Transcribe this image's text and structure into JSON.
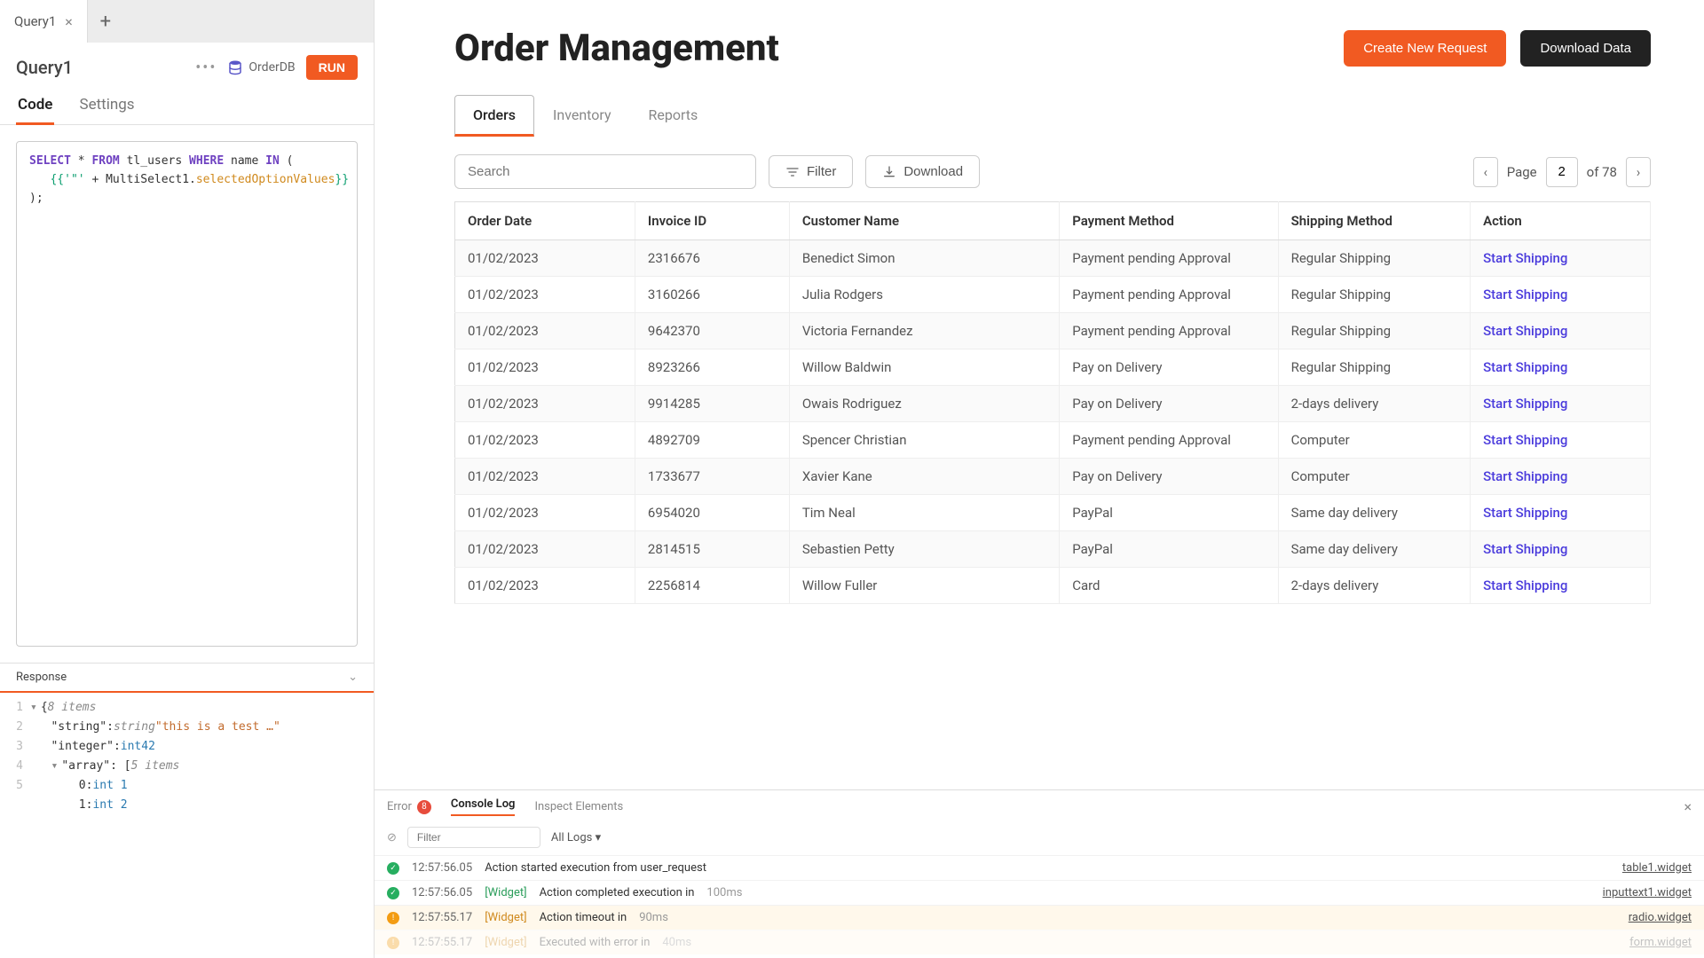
{
  "left": {
    "tab_name": "Query1",
    "query_title": "Query1",
    "db_name": "OrderDB",
    "run_label": "RUN",
    "inner_tabs": {
      "code": "Code",
      "settings": "Settings"
    },
    "sql_kw_select": "SELECT",
    "sql_kw_from": "FROM",
    "sql_kw_where": "WHERE",
    "sql_kw_in": "IN",
    "sql_table": "tl_users",
    "sql_col": "name",
    "sql_bind_open": "{{'\"'",
    "sql_bind_obj": " + MultiSelect1.",
    "sql_bind_prop": "selectedOptionValues",
    "sql_bind_close": "}}",
    "response_label": "Response",
    "json": {
      "items_count": "8 items",
      "k_string": "\"string\"",
      "t_string": "string",
      "v_string": "\"this is a test …\"",
      "k_integer": "\"integer\"",
      "t_int": "int",
      "v_int": "42",
      "k_array": "\"array\"",
      "arr_count": "5 items",
      "idx0": "0",
      "v0": "int 1",
      "idx1": "1",
      "v1": "int 2"
    }
  },
  "page": {
    "title": "Order Management",
    "btn_create": "Create New Request",
    "btn_download": "Download Data",
    "tabs": {
      "orders": "Orders",
      "inventory": "Inventory",
      "reports": "Reports"
    },
    "search_placeholder": "Search",
    "filter_label": "Filter",
    "download_label": "Download",
    "page_label": "Page",
    "page_current": "2",
    "page_of": "of 78"
  },
  "table": {
    "headers": {
      "date": "Order Date",
      "invoice": "Invoice ID",
      "customer": "Customer Name",
      "payment": "Payment Method",
      "shipping": "Shipping Method",
      "action": "Action"
    },
    "action_label": "Start Shipping",
    "rows": [
      {
        "date": "01/02/2023",
        "invoice": "2316676",
        "customer": "Benedict Simon",
        "payment": "Payment pending Approval",
        "shipping": "Regular Shipping"
      },
      {
        "date": "01/02/2023",
        "invoice": "3160266",
        "customer": "Julia Rodgers",
        "payment": "Payment pending Approval",
        "shipping": "Regular Shipping"
      },
      {
        "date": "01/02/2023",
        "invoice": "9642370",
        "customer": "Victoria Fernandez",
        "payment": "Payment pending Approval",
        "shipping": "Regular Shipping"
      },
      {
        "date": "01/02/2023",
        "invoice": "8923266",
        "customer": "Willow Baldwin",
        "payment": "Pay on Delivery",
        "shipping": "Regular Shipping"
      },
      {
        "date": "01/02/2023",
        "invoice": "9914285",
        "customer": "Owais Rodriguez",
        "payment": "Pay on Delivery",
        "shipping": "2-days delivery"
      },
      {
        "date": "01/02/2023",
        "invoice": "4892709",
        "customer": "Spencer Christian",
        "payment": "Payment pending Approval",
        "shipping": "Computer"
      },
      {
        "date": "01/02/2023",
        "invoice": "1733677",
        "customer": "Xavier Kane",
        "payment": "Pay on Delivery",
        "shipping": "Computer"
      },
      {
        "date": "01/02/2023",
        "invoice": "6954020",
        "customer": "Tim Neal",
        "payment": "PayPal",
        "shipping": "Same day delivery"
      },
      {
        "date": "01/02/2023",
        "invoice": "2814515",
        "customer": "Sebastien Petty",
        "payment": "PayPal",
        "shipping": "Same day delivery"
      },
      {
        "date": "01/02/2023",
        "invoice": "2256814",
        "customer": "Willow Fuller",
        "payment": "Card",
        "shipping": "2-days delivery"
      }
    ]
  },
  "console": {
    "tab_error": "Error",
    "error_count": "8",
    "tab_console": "Console Log",
    "tab_inspect": "Inspect Elements",
    "filter_placeholder": "Filter",
    "dropdown": "All Logs",
    "rows": [
      {
        "status": "ok",
        "time": "12:57:56.05",
        "tag": "",
        "msg": "Action started execution from user_request",
        "ms": "",
        "widget": "table1.widget"
      },
      {
        "status": "ok",
        "time": "12:57:56.05",
        "tag": "[Widget]",
        "msg": "Action completed execution in",
        "ms": "100ms",
        "widget": "inputtext1.widget"
      },
      {
        "status": "warn",
        "time": "12:57:55.17",
        "tag": "[Widget]",
        "msg": "Action timeout in",
        "ms": "90ms",
        "widget": "radio.widget"
      },
      {
        "status": "warn",
        "time": "12:57:55.17",
        "tag": "[Widget]",
        "msg": "Executed with error in",
        "ms": "40ms",
        "widget": "form.widget"
      }
    ]
  }
}
